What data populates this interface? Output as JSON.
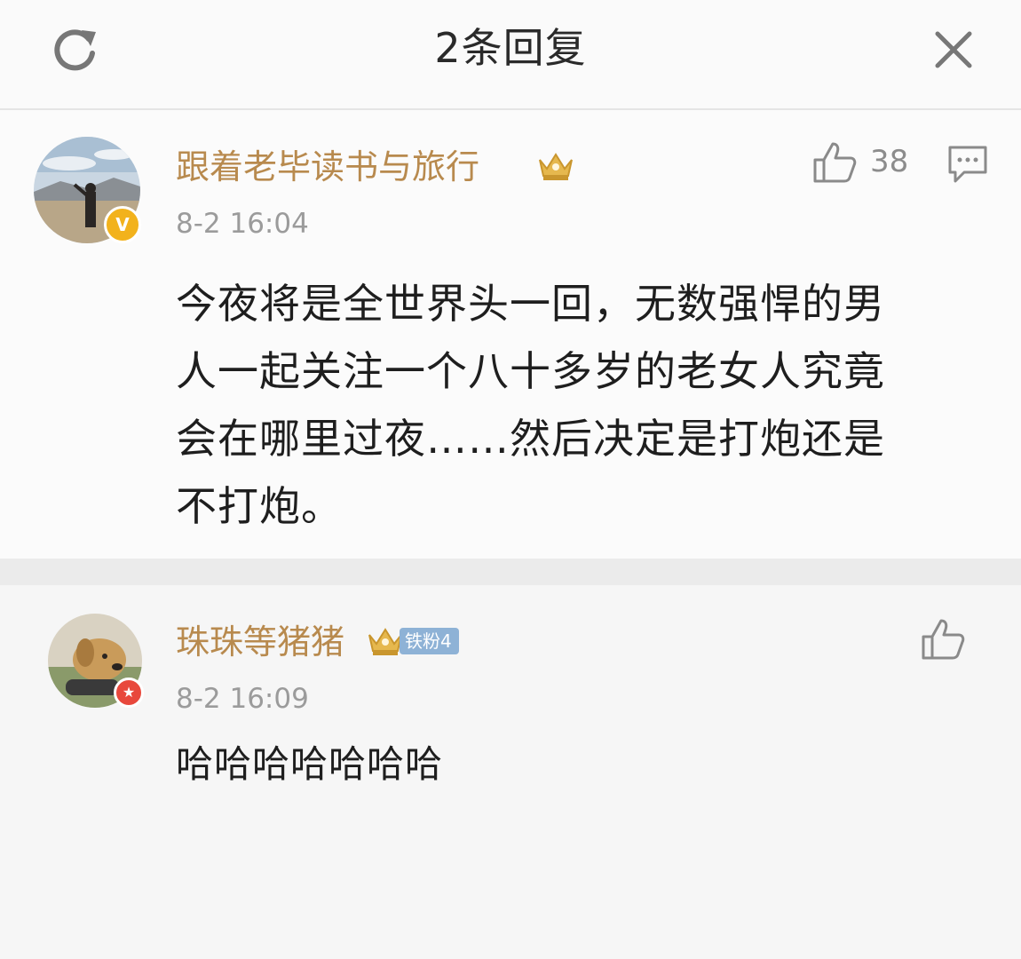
{
  "header": {
    "title": "2条回复"
  },
  "comments": [
    {
      "username": "跟着老毕读书与旅行",
      "timestamp": "8-2 16:04",
      "likes": "38",
      "verified_badge": "V",
      "body_lines": [
        "今夜将是全世界头一回，无数强悍的男",
        "人一起关注一个八十多岁的老女人究竟",
        "会在哪里过夜……然后决定是打炮还是",
        "不打炮。"
      ]
    },
    {
      "username": "珠珠等猪猪",
      "fan_badge": "铁粉4",
      "timestamp": "8-2 16:09",
      "body_lines": [
        "哈哈哈哈哈哈哈"
      ]
    }
  ],
  "colors": {
    "username": "#b88a4e",
    "timestamp": "#9b9b9b",
    "icon": "#8a8a8a",
    "crown": "#e0b24a",
    "verified": "#f2b21c",
    "fan_badge": "#8eb2d6"
  },
  "icons": [
    "refresh-icon",
    "close-icon",
    "crown-icon",
    "thumbs-up-icon",
    "comment-icon"
  ]
}
